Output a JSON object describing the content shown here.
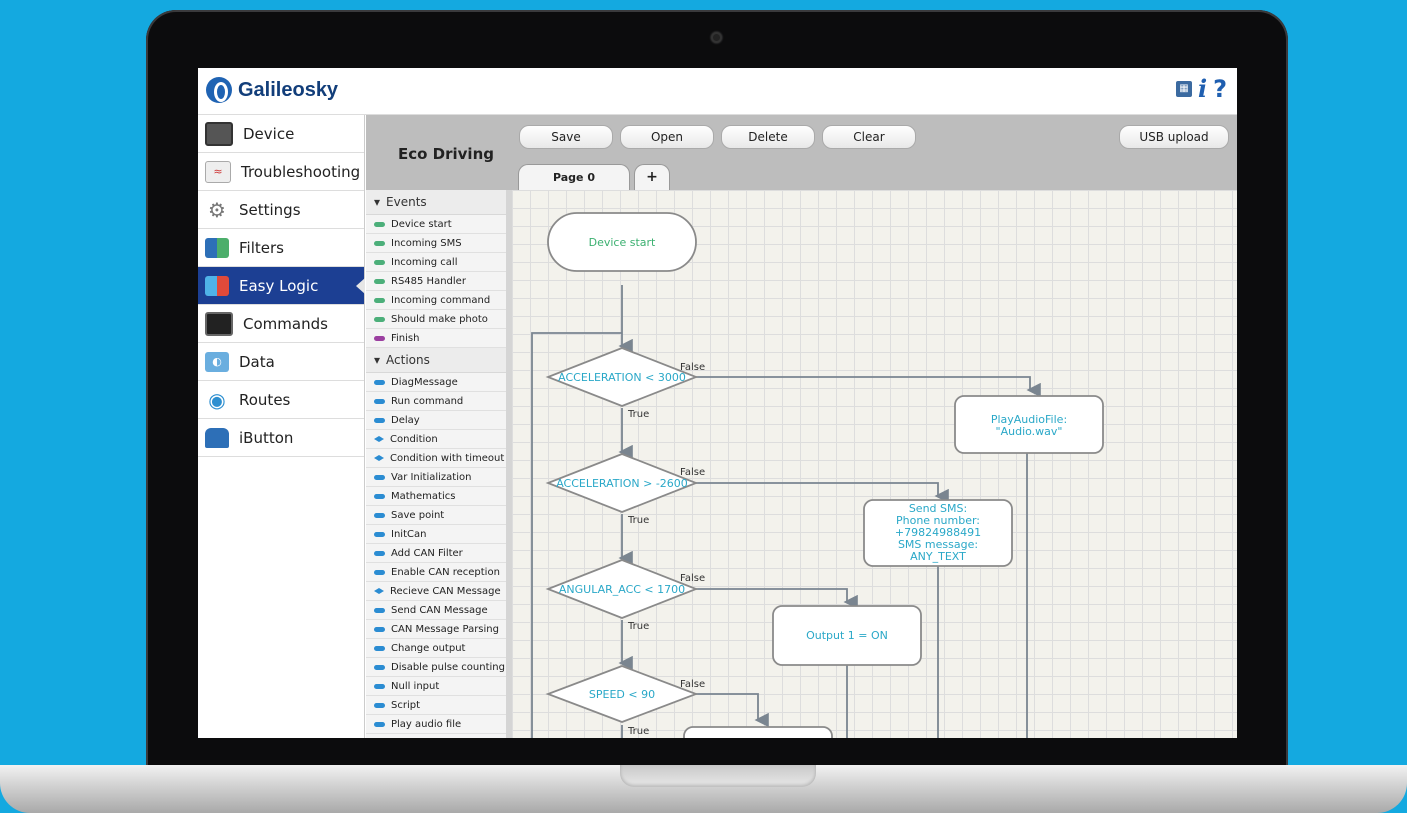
{
  "app": {
    "logo_text": "Galileosky",
    "title": "Eco Driving"
  },
  "top_icons": {
    "info": "i",
    "help": "?"
  },
  "nav": [
    {
      "label": "Device",
      "icon": "device-icon",
      "color": "#555"
    },
    {
      "label": "Troubleshooting",
      "icon": "chart-icon",
      "color": "#ccc"
    },
    {
      "label": "Settings",
      "icon": "gear-icon",
      "color": "#888"
    },
    {
      "label": "Filters",
      "icon": "filter-icon",
      "color": "#2d6fb7"
    },
    {
      "label": "Easy Logic",
      "icon": "logic-icon",
      "color": "#2d6fb7",
      "active": true
    },
    {
      "label": "Commands",
      "icon": "terminal-icon",
      "color": "#222"
    },
    {
      "label": "Data",
      "icon": "data-icon",
      "color": "#5aa0d8"
    },
    {
      "label": "Routes",
      "icon": "pin-icon",
      "color": "#2d8fd0"
    },
    {
      "label": "iButton",
      "icon": "lock-icon",
      "color": "#2d6fb7"
    }
  ],
  "toolbar": {
    "save": "Save",
    "open": "Open",
    "delete": "Delete",
    "clear": "Clear",
    "usb_upload": "USB upload"
  },
  "tabs": {
    "page0": "Page 0",
    "add": "+"
  },
  "palette": {
    "events_header": "Events",
    "events": [
      "Device start",
      "Incoming SMS",
      "Incoming call",
      "RS485 Handler",
      "Incoming command",
      "Should make photo",
      "Finish"
    ],
    "actions_header": "Actions",
    "actions": [
      "DiagMessage",
      "Run command",
      "Delay",
      "Condition",
      "Condition with timeout",
      "Var Initialization",
      "Mathematics",
      "Save point",
      "InitCan",
      "Add CAN Filter",
      "Enable CAN reception",
      "Recieve CAN Message",
      "Send CAN Message",
      "CAN Message Parsing",
      "Change output",
      "Disable pulse counting",
      "Null input",
      "Script",
      "Play audio file"
    ],
    "colors": {
      "event": "#4caf7a",
      "finish": "#9b3fa0",
      "action": "#2b8cd2"
    }
  },
  "flow": {
    "start": "Device start",
    "conditions": [
      "ACCELERATION < 3000",
      "ACCELERATION > -2600",
      "ANGULAR_ACC < 1700",
      "SPEED < 90"
    ],
    "true_label": "True",
    "false_label": "False",
    "play_audio": [
      "PlayAudioFile:",
      "\"Audio.wav\""
    ],
    "send_sms": [
      "Send SMS:",
      "Phone number:",
      "+79824988491",
      "SMS message:",
      "ANY_TEXT"
    ],
    "output": "Output 1 = ON"
  }
}
